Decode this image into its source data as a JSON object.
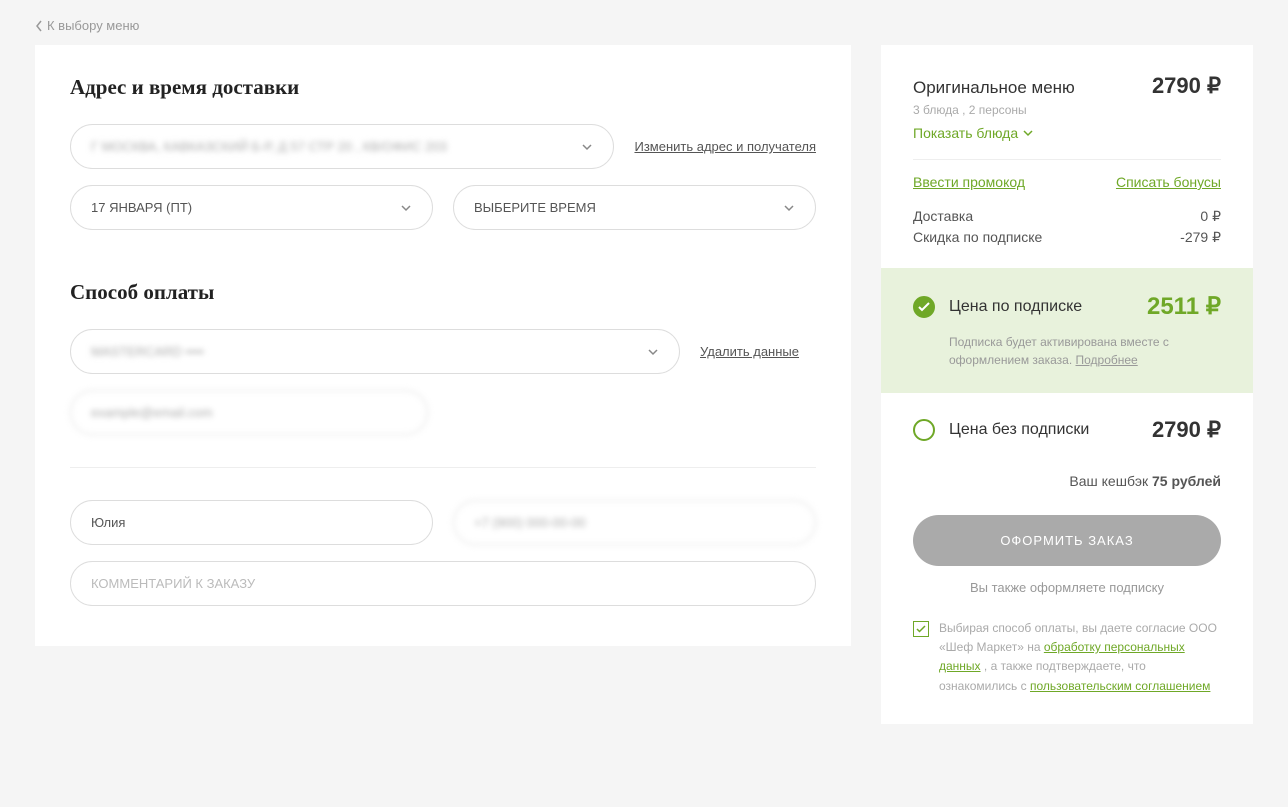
{
  "back_link": "К выбору меню",
  "delivery": {
    "title": "Адрес и время доставки",
    "address": "Г МОСКВА, КАВКАЗСКИЙ Б-Р, Д 57 СТР 20 , КВ/ОФИС 203",
    "change_link": "Изменить адрес и получателя",
    "date": "17 ЯНВАРЯ (ПТ)",
    "time_placeholder": "ВЫБЕРИТЕ ВРЕМЯ"
  },
  "payment": {
    "title": "Способ оплаты",
    "card": "MASTERCARD ••••",
    "delete_link": "Удалить данные",
    "email": "example@email.com"
  },
  "customer": {
    "name": "Юлия",
    "phone": "+7 (900) 000-00-00",
    "comment_placeholder": "КОММЕНТАРИЙ К ЗАКАЗУ"
  },
  "summary": {
    "menu_name": "Оригинальное меню",
    "menu_price": "2790 ₽",
    "menu_sub": "3 блюда , 2 персоны",
    "show_dishes": "Показать блюда",
    "promo_link": "Ввести промокод",
    "bonus_link": "Списать бонусы",
    "delivery_label": "Доставка",
    "delivery_value": "0 ₽",
    "discount_label": "Скидка по подписке",
    "discount_value": "-279 ₽",
    "sub_price_label": "Цена по подписке",
    "sub_price_value": "2511 ₽",
    "sub_note_1": "Подписка будет активирована вместе с оформлением заказа.",
    "sub_note_more": "Подробнее",
    "nosub_label": "Цена без подписки",
    "nosub_value": "2790 ₽",
    "cashback_prefix": "Ваш кешбэк ",
    "cashback_bold": "75 рублей",
    "submit": "ОФОРМИТЬ ЗАКАЗ",
    "also_sub": "Вы также оформляете подписку",
    "consent_1": "Выбирая способ оплаты, вы даете согласие ООО «Шеф Маркет» на ",
    "consent_link1": "обработку персональных данных",
    "consent_2": " , а также подтверждаете, что ознакомились с ",
    "consent_link2": "пользовательским соглашением"
  }
}
